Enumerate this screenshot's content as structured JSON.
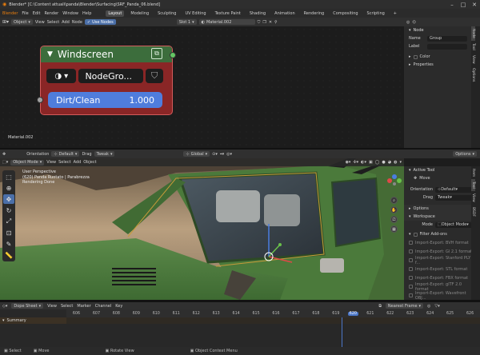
{
  "window": {
    "title": "Blender* [C:\\Content attuali\\panda\\Blender\\Surfacing\\SRF_Panda_06.blend]"
  },
  "menu": [
    "Blender",
    "File",
    "Edit",
    "Render",
    "Window",
    "Help"
  ],
  "workspaces": [
    "Layout",
    "Modeling",
    "Sculpting",
    "UV Editing",
    "Texture Paint",
    "Shading",
    "Animation",
    "Rendering",
    "Compositing",
    "Scripting",
    "+"
  ],
  "node_editor": {
    "header": {
      "type": "Object",
      "menus": [
        "View",
        "Select",
        "Add",
        "Node"
      ],
      "use_nodes": "Use Nodes",
      "slot": "Slot 1",
      "material": "Material.002"
    },
    "node": {
      "title": "Windscreen",
      "group": "NodeGro...",
      "param": {
        "label": "Dirt/Clean",
        "value": "1.000"
      }
    },
    "material_label": "Material.002"
  },
  "side_panel": {
    "section": "Node",
    "name_label": "Name",
    "name_value": "Group",
    "label_label": "Label",
    "color": "Color",
    "properties": "Properties",
    "tabs": [
      "Node",
      "Tool",
      "View",
      "Options"
    ]
  },
  "viewport": {
    "header": {
      "orientation_label": "Orientation",
      "orientation": "Default",
      "drag_label": "Drag",
      "drag": "Tweak",
      "transform": "Global",
      "options": "Options",
      "mode": "Object Mode",
      "menus": [
        "View",
        "Select",
        "Add",
        "Object"
      ]
    },
    "overlay": {
      "line1": "User Perspective",
      "line2": "(620) Panda Ruotato | Parabrezza",
      "line3": "Rendering Done"
    }
  },
  "tool_panel": {
    "active_tool": "Active Tool",
    "tool": "Move",
    "orientation_label": "Orientation",
    "orientation": "Default",
    "drag_label": "Drag",
    "drag": "Tweak",
    "options": "Options",
    "workspace": "Workspace",
    "mode_label": "Mode",
    "mode": "Object Mode",
    "filter_addons": "Filter Add-ons",
    "addons": [
      "Import-Export: BVH format",
      "Import-Export: Gl 2.1 format",
      "Import-Export: Stanford PLY f...",
      "Import-Export: STL format",
      "Import-Export: FBX format",
      "Import-Export: glTF 2.0 format",
      "Import-Export: Wavefront OBJ..."
    ],
    "tabs": [
      "Item",
      "Tool",
      "View",
      "BSDF"
    ]
  },
  "dope_sheet": {
    "editor": "Dope Sheet",
    "menus": [
      "View",
      "Select",
      "Marker",
      "Channel",
      "Key"
    ],
    "snap": "Nearest Frame",
    "summary": "Summary",
    "frames": [
      "606",
      "607",
      "608",
      "609",
      "610",
      "611",
      "612",
      "613",
      "614",
      "615",
      "616",
      "617",
      "618",
      "619",
      "620",
      "621",
      "622",
      "623",
      "624",
      "625",
      "626"
    ],
    "current_frame": "620"
  },
  "status_bar": [
    "Select",
    "Move",
    "Rotate View",
    "Object Context Menu"
  ]
}
